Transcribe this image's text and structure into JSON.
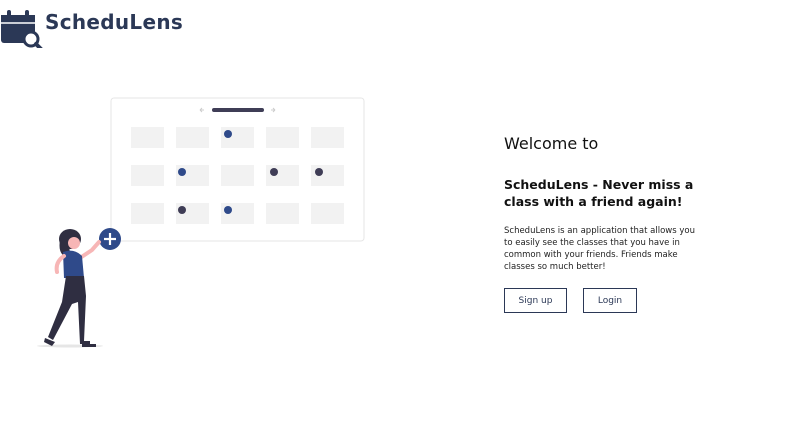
{
  "header": {
    "brand": "ScheduLens",
    "logo_icon": "calendar-search-icon"
  },
  "welcome": {
    "title": "Welcome to",
    "headline": "ScheduLens - Never miss a class with a friend again!",
    "description": "ScheduLens is an application that allows you to easily see the classes that you have in common with your friends. Friends make classes so much better!"
  },
  "actions": {
    "signup_label": "Sign up",
    "login_label": "Login"
  },
  "illustration": {
    "name": "person-adding-to-calendar",
    "add_icon": "plus-circle-icon"
  },
  "colors": {
    "brand": "#2b3856",
    "accent": "#2f4a8a",
    "dot_dark": "#3f3d56",
    "cell": "#f2f2f2"
  }
}
